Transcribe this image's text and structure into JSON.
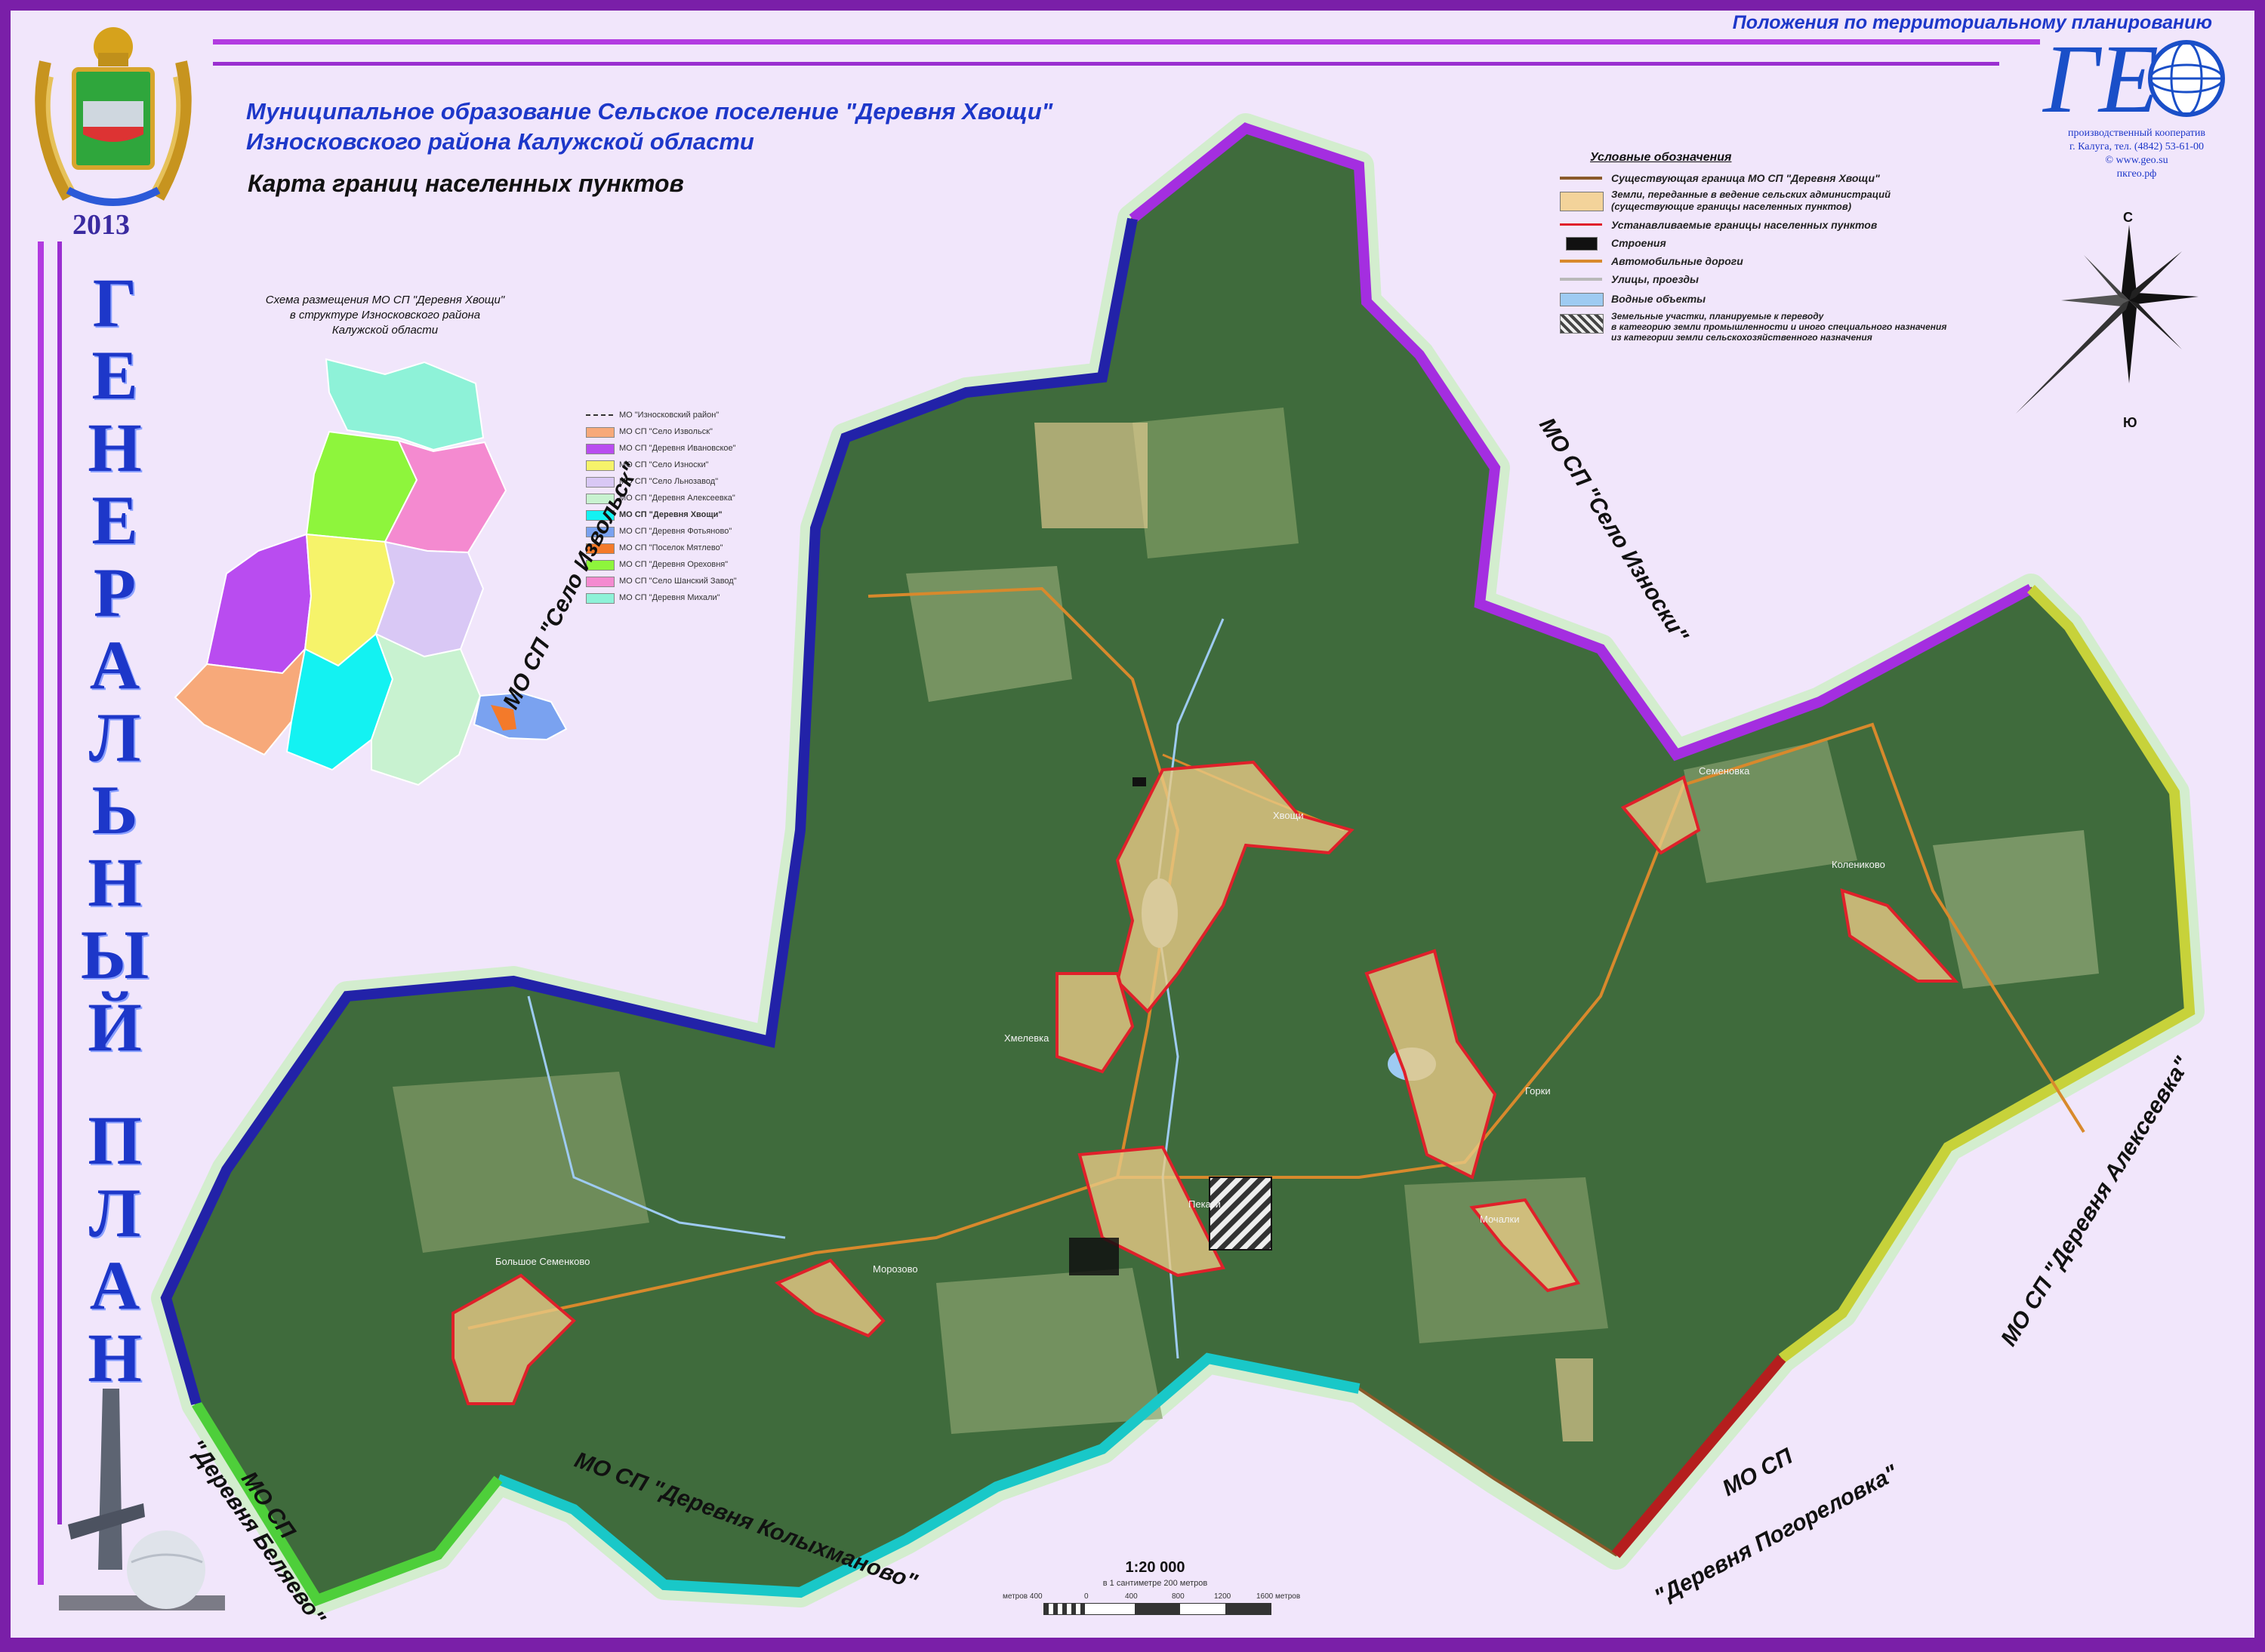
{
  "header": {
    "top_right": "Положения по территориальному планированию",
    "title_line1": "Муниципальное образование Сельское поселение \"Деревня Хвощи\"",
    "title_line2": "Износковского района Калужской области",
    "subtitle": "Карта границ населенных пунктов"
  },
  "emblem": {
    "year": "2013"
  },
  "vertical_title": {
    "word1": [
      "Г",
      "Е",
      "Н",
      "Е",
      "Р",
      "А",
      "Л",
      "Ь",
      "Н",
      "Ы",
      "Й"
    ],
    "word2": [
      "П",
      "Л",
      "А",
      "Н"
    ]
  },
  "logo": {
    "line1": "производственный кооператив",
    "line2": "г. Калуга, тел. (4842) 53-61-00",
    "line3": "© www.geo.su",
    "line4": "пкгео.рф"
  },
  "legend": {
    "title": "Условные обозначения",
    "items": [
      {
        "label": "Существующая граница МО СП \"Деревня Хвощи\"",
        "color": "#8a5a2a",
        "kind": "line"
      },
      {
        "label": "Земли, переданные в ведение сельских администраций\n(существующие границы населенных пунктов)",
        "color": "#f3d39a",
        "kind": "fill"
      },
      {
        "label": "Устанавливаемые границы населенных пунктов",
        "color": "#e0202a",
        "kind": "line"
      },
      {
        "label": "Строения",
        "color": "#111111",
        "kind": "fill"
      },
      {
        "label": "Автомобильные дороги",
        "color": "#d8892c",
        "kind": "line"
      },
      {
        "label": "Улицы, проезды",
        "color": "#b9b9b9",
        "kind": "line"
      },
      {
        "label": "Водные объекты",
        "color": "#9ecbf2",
        "kind": "fill"
      },
      {
        "label": "Земельные участки, планируемые к переводу\nв категорию земли промышленности и иного специального назначения\nиз категории земли сельскохозяйственного назначения",
        "color": "#666666",
        "kind": "hatch"
      }
    ]
  },
  "compass": {
    "north": "С",
    "south": "Ю"
  },
  "inset": {
    "title": "Схема размещения МО СП \"Деревня Хвощи\"\nв структуре Износковского района\nКалужской области",
    "legend": [
      {
        "label": "МО \"Износковский район\"",
        "color": "#333333",
        "kind": "dash"
      },
      {
        "label": "МО СП \"Село Извольск\"",
        "color": "#f7a97a"
      },
      {
        "label": "МО СП \"Деревня Ивановское\"",
        "color": "#b94cf0"
      },
      {
        "label": "МО СП \"Село Износки\"",
        "color": "#f6f36a"
      },
      {
        "label": "МО СП \"Село Льнозавод\"",
        "color": "#d9c8f5"
      },
      {
        "label": "МО СП \"Деревня Алексеевка\"",
        "color": "#c8f2d0"
      },
      {
        "label": "МО СП \"Деревня Хвощи\"",
        "color": "#13f2f2",
        "bold": true
      },
      {
        "label": "МО СП \"Деревня Фотьяново\"",
        "color": "#7aa2f0"
      },
      {
        "label": "МО СП \"Поселок Мятлево\"",
        "color": "#f47a2a"
      },
      {
        "label": "МО СП \"Деревня Ореховня\"",
        "color": "#8ef53c"
      },
      {
        "label": "МО СП \"Село Шанский Завод\"",
        "color": "#f48ad0"
      },
      {
        "label": "МО СП \"Деревня Михали\"",
        "color": "#8ef2d8"
      }
    ]
  },
  "neighbors": {
    "izvolsk": "МО СП \"Село Извольск\"",
    "iznoski": "МО СП \"Село Износки\"",
    "alekseevka": "МО СП \"Деревня Алексеевка\"",
    "pogorelovka_1": "МО СП",
    "pogorelovka_2": "\"Деревня Погореловка\"",
    "kolykhmanovo": "МО СП \"Деревня Колыхманово\"",
    "belyaevo_1": "МО СП",
    "belyaevo_2": "\"Деревня Беляево\""
  },
  "villages": {
    "khvoshchi": "Хвощи",
    "khmelevka": "Хмелевка",
    "gorki": "Горки",
    "penkazi": "Пекази",
    "mochalki": "Мочалки",
    "morozovo": "Морозово",
    "bolshoe_semenkovo": "Большое Семенково",
    "semenovo": "Семеновка",
    "kolenovo": "Колениково"
  },
  "scale": {
    "ratio": "1:20 000",
    "note": "в 1 сантиметре 200 метров",
    "ticks": [
      "метров 400",
      "0",
      "400",
      "800",
      "1200",
      "1600 метров"
    ]
  }
}
